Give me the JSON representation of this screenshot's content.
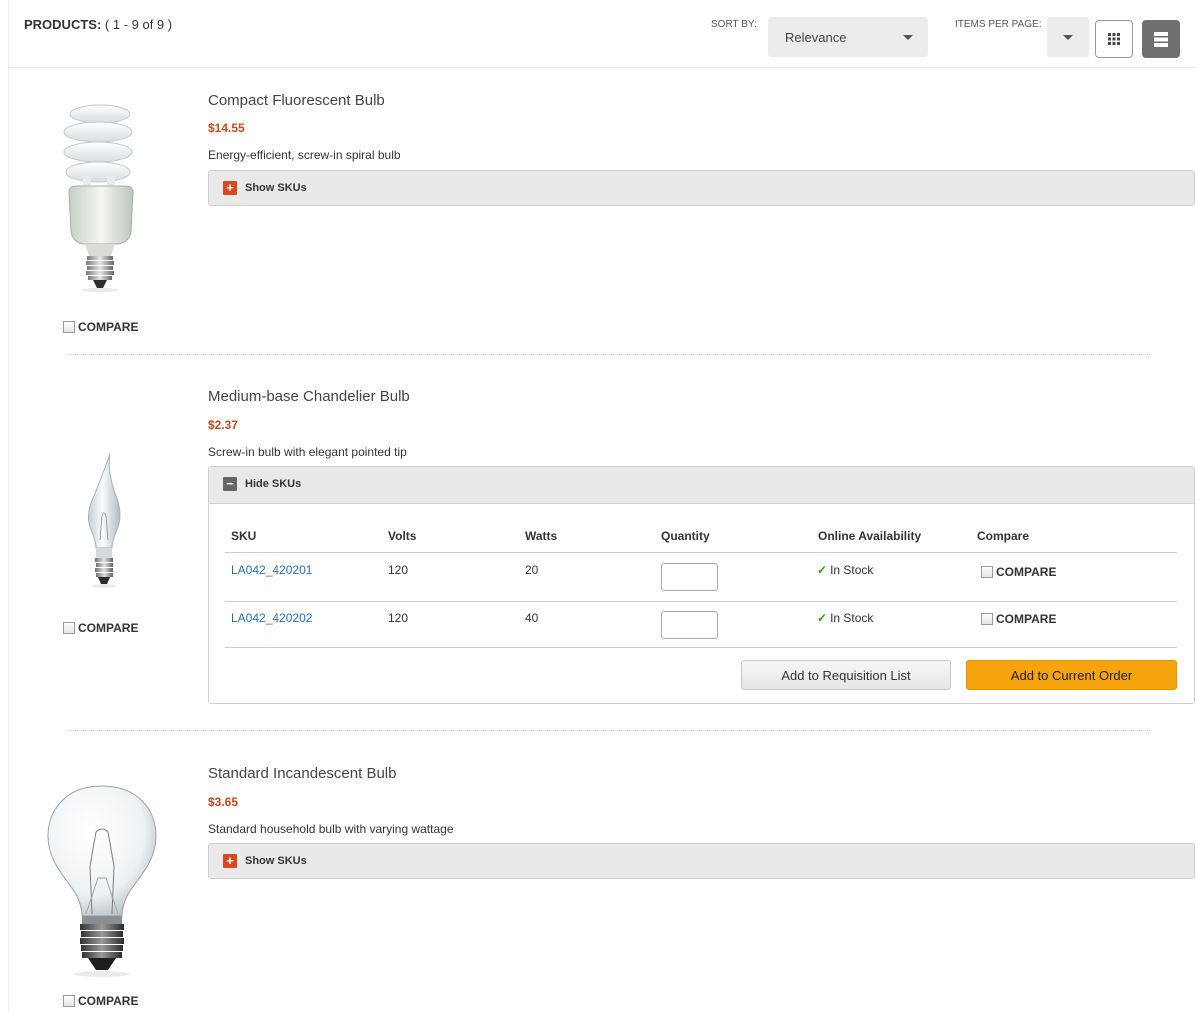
{
  "header": {
    "products_label": "PRODUCTS:",
    "products_range": "( 1 - 9 of 9 )",
    "sort_by_label": "SORT BY:",
    "sort_value": "Relevance",
    "items_per_page_label": "ITEMS PER PAGE:",
    "items_per_page_value": "",
    "view_modes": [
      "grid-view-icon",
      "list-view-icon"
    ],
    "active_view": "list"
  },
  "products": [
    {
      "name": "Compact Fluorescent Bulb",
      "price": "$14.55",
      "description": "Energy-efficient, screw-in spiral bulb",
      "sku_toggle_label": "Show SKUs",
      "compare_label": "COMPARE",
      "image_icon": "cfl-spiral-bulb"
    },
    {
      "name": "Medium-base Chandelier Bulb",
      "price": "$2.37",
      "description": "Screw-in bulb with elegant pointed tip",
      "sku_toggle_label": "Hide SKUs",
      "compare_label": "COMPARE",
      "image_icon": "chandelier-bulb",
      "sku_table": {
        "columns": [
          "SKU",
          "Volts",
          "Watts",
          "Quantity",
          "Online Availability",
          "Compare"
        ],
        "rows": [
          {
            "sku": "LA042_420201",
            "volts": "120",
            "watts": "20",
            "quantity": "",
            "availability": "In Stock",
            "compare": "COMPARE"
          },
          {
            "sku": "LA042_420202",
            "volts": "120",
            "watts": "40",
            "quantity": "",
            "availability": "In Stock",
            "compare": "COMPARE"
          }
        ],
        "add_to_requisition_label": "Add to Requisition List",
        "add_to_order_label": "Add to Current Order"
      }
    },
    {
      "name": "Standard Incandescent Bulb",
      "price": "$3.65",
      "description": "Standard household bulb with varying wattage",
      "sku_toggle_label": "Show SKUs",
      "compare_label": "COMPARE",
      "image_icon": "incandescent-bulb"
    }
  ],
  "colors": {
    "price": "#c9481b",
    "toggle_plus": "#d9471b",
    "sku_link": "#2a6ebb",
    "order_button": "#f5a40e",
    "in_stock_check": "#3a9a1a"
  }
}
